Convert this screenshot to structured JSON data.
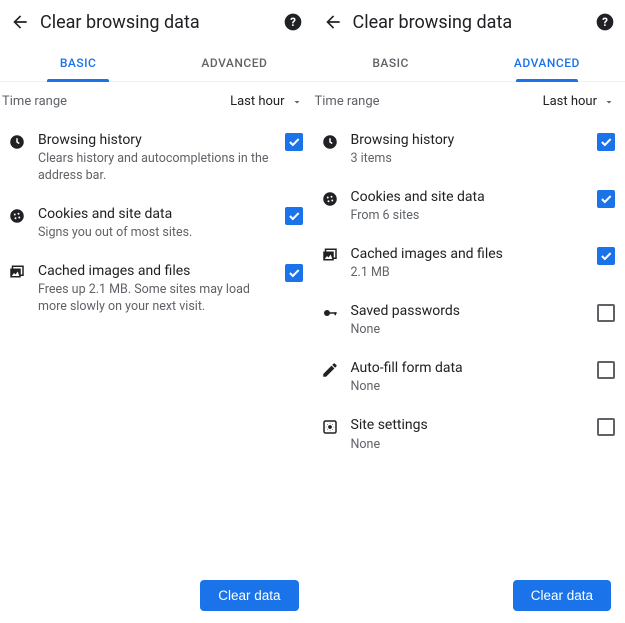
{
  "panes": [
    {
      "title": "Clear browsing data",
      "tabs": [
        {
          "label": "BASIC",
          "active": true
        },
        {
          "label": "ADVANCED",
          "active": false
        }
      ],
      "time_range": {
        "label": "Time range",
        "value": "Last hour"
      },
      "items": [
        {
          "icon": "clock-icon",
          "title": "Browsing history",
          "sub": "Clears history and autocompletions in the address bar.",
          "checked": true
        },
        {
          "icon": "cookie-icon",
          "title": "Cookies and site data",
          "sub": "Signs you out of most sites.",
          "checked": true
        },
        {
          "icon": "image-icon",
          "title": "Cached images and files",
          "sub": "Frees up 2.1 MB. Some sites may load more slowly on your next visit.",
          "checked": true
        }
      ],
      "clear_label": "Clear data"
    },
    {
      "title": "Clear browsing data",
      "tabs": [
        {
          "label": "BASIC",
          "active": false
        },
        {
          "label": "ADVANCED",
          "active": true
        }
      ],
      "time_range": {
        "label": "Time range",
        "value": "Last hour"
      },
      "items": [
        {
          "icon": "clock-icon",
          "title": "Browsing history",
          "sub": "3 items",
          "checked": true
        },
        {
          "icon": "cookie-icon",
          "title": "Cookies and site data",
          "sub": "From 6 sites",
          "checked": true
        },
        {
          "icon": "image-icon",
          "title": "Cached images and files",
          "sub": "2.1 MB",
          "checked": true
        },
        {
          "icon": "key-icon",
          "title": "Saved passwords",
          "sub": "None",
          "checked": false
        },
        {
          "icon": "pencil-icon",
          "title": "Auto-fill form data",
          "sub": "None",
          "checked": false
        },
        {
          "icon": "gear-icon",
          "title": "Site settings",
          "sub": "None",
          "checked": false
        }
      ],
      "clear_label": "Clear data"
    }
  ]
}
